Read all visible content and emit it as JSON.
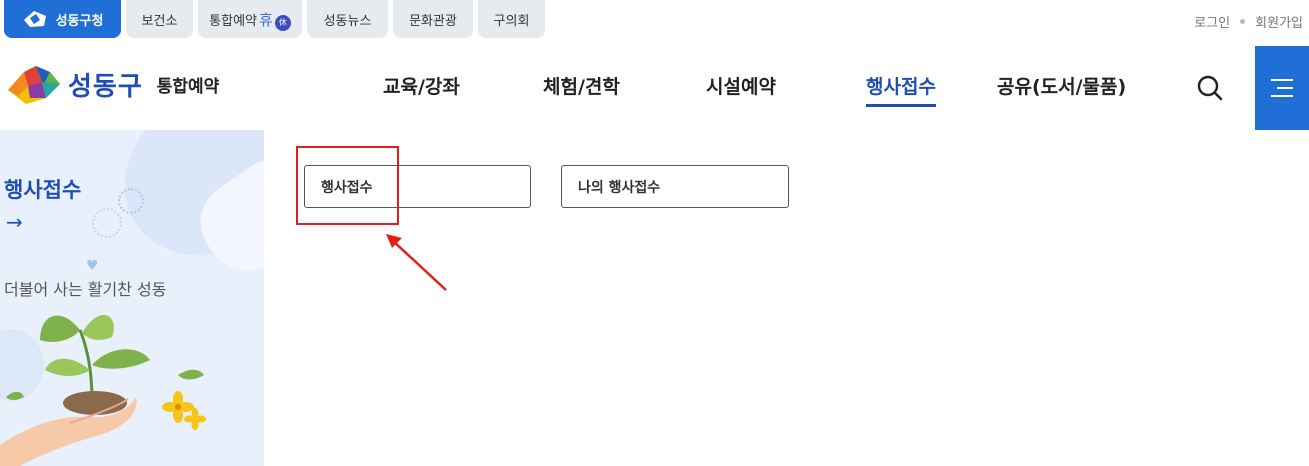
{
  "topbar": {
    "sites": [
      "성동구청",
      "보건소",
      "통합예약",
      "성동뉴스",
      "문화관광",
      "구의회"
    ],
    "hyu_char": "휴",
    "badge_char": "休",
    "login": "로그인",
    "join": "회원가입"
  },
  "header": {
    "brand_name": "성동구",
    "brand_sub": "통합예약",
    "nav": [
      "교육/강좌",
      "체험/견학",
      "시설예약",
      "행사접수",
      "공유(도서/물품)"
    ],
    "active_nav": "행사접수"
  },
  "side": {
    "title": "행사접수",
    "arrow": "→",
    "slogan": "더불어 사는  활기찬 성동",
    "heart": "♥"
  },
  "main": {
    "tabs": [
      "행사접수",
      "나의 행사접수"
    ]
  },
  "colors": {
    "brand_blue": "#1f6fd6",
    "nav_active": "#1f4fb0",
    "highlight_red": "#e41d1d"
  }
}
